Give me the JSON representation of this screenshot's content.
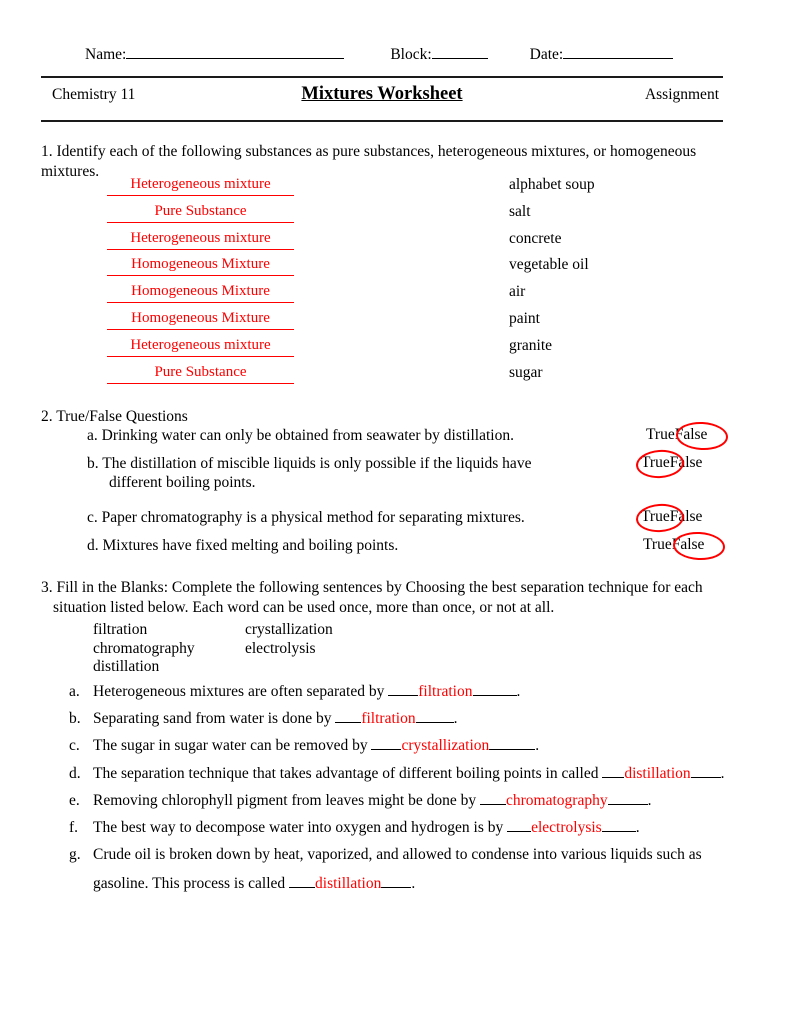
{
  "header": {
    "name_label": "Name:",
    "block_label": "Block:",
    "date_label": "Date:",
    "course": "Chemistry 11",
    "title": "Mixtures Worksheet",
    "assignment": "Assignment"
  },
  "q1": {
    "prompt": "1. Identify each of the following substances as pure substances, heterogeneous mixtures, or homogeneous mixtures.",
    "rows": [
      {
        "answer": "Heterogeneous mixture",
        "substance": "alphabet soup"
      },
      {
        "answer": "Pure Substance",
        "substance": "salt"
      },
      {
        "answer": "Heterogeneous mixture",
        "substance": "concrete"
      },
      {
        "answer": "Homogeneous Mixture",
        "substance": "vegetable oil"
      },
      {
        "answer": "Homogeneous Mixture",
        "substance": "air"
      },
      {
        "answer": "Homogeneous Mixture",
        "substance": "paint"
      },
      {
        "answer": "Heterogeneous mixture",
        "substance": "granite"
      },
      {
        "answer": "Pure Substance",
        "substance": "sugar"
      }
    ]
  },
  "q2": {
    "heading": "2. True/False Questions",
    "true_label": "True",
    "false_label": "False",
    "items": [
      {
        "letter": "a.",
        "text": "a. Drinking water can only be obtained from seawater by distillation.",
        "continuation": "",
        "selected": "False"
      },
      {
        "letter": "b.",
        "text": "b. The distillation of miscible liquids is only possible if the liquids have",
        "continuation": "different boiling points.",
        "selected": "True"
      },
      {
        "letter": "c.",
        "text": "c. Paper chromatography is a physical method for separating mixtures.",
        "continuation": "",
        "selected": "True"
      },
      {
        "letter": "d.",
        "text": "d. Mixtures have fixed melting and boiling points.",
        "continuation": "",
        "selected": "False"
      }
    ]
  },
  "q3": {
    "prompt_line1": "3. Fill in the Blanks: Complete the following sentences by Choosing the best separation technique for each",
    "prompt_line2": "situation listed below. Each word can be used once, more than once, or not at all.",
    "wordbank": [
      {
        "col1": "filtration",
        "col2": "crystallization"
      },
      {
        "col1": "chromatography",
        "col2": "electrolysis"
      },
      {
        "col1": "distillation",
        "col2": ""
      }
    ],
    "items": [
      {
        "letter": "a.",
        "before": "Heterogeneous mixtures are often separated by",
        "answer": "filtration",
        "after": ".",
        "continuation": ""
      },
      {
        "letter": "b.",
        "before": "Separating sand from water is done by",
        "answer": "filtration",
        "after": ".",
        "continuation": ""
      },
      {
        "letter": "c.",
        "before": "The sugar in sugar water can be removed by",
        "answer": "crystallization",
        "after": ".",
        "continuation": ""
      },
      {
        "letter": "d.",
        "before": "The separation technique that takes advantage of different boiling points in called",
        "answer": "distillation",
        "after": ".",
        "continuation": ""
      },
      {
        "letter": "e.",
        "before": "Removing chlorophyll pigment from leaves might be done by",
        "answer": "chromatography",
        "after": ".",
        "continuation": ""
      },
      {
        "letter": "f.",
        "before": "The best way to decompose water into oxygen and hydrogen is by",
        "answer": "electrolysis",
        "after": ".",
        "continuation": ""
      },
      {
        "letter": "g.",
        "before": "Crude oil is broken down by heat, vaporized, and allowed to condense into various liquids such as",
        "answer": "distillation",
        "after": ".",
        "continuation": "gasoline.  This process is called"
      }
    ]
  },
  "colors": {
    "ink_red": "#ff0000",
    "text_black": "#000000"
  }
}
